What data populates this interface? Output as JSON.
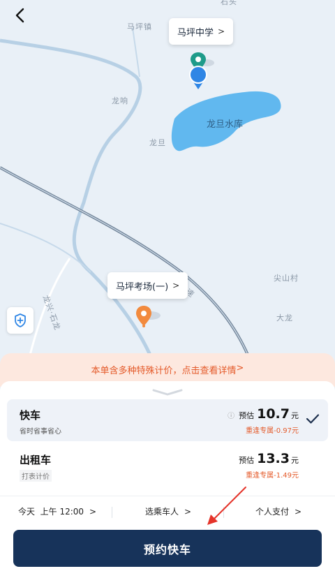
{
  "map": {
    "labels": {
      "top_village": "石头",
      "mapingzhen": "马坪镇",
      "longxiang": "龙响",
      "longdan": "龙旦",
      "jianshan": "尖山村",
      "dalong": "大龙",
      "road_a": "龙兴·石龙",
      "road_b": "高速"
    },
    "lake_label": "龙旦水库",
    "destination_callout": {
      "text": "马坪中学",
      "chevron": ">"
    },
    "origin_callout": {
      "text": "马坪考场(一)",
      "chevron": ">"
    },
    "colors": {
      "water": "#61b8ef",
      "road": "#b7d0e5",
      "highway": "#6e8196",
      "dest_pin": "#1e9b8a",
      "origin_pin": "#f28a3e",
      "current_location": "#2f86e5"
    }
  },
  "notice": {
    "text": "本单含多种特殊计价，点击查看详情",
    "chevron": ">"
  },
  "rides": [
    {
      "name": "快车",
      "subtitle": "省时省事省心",
      "est_prefix": "预估",
      "price": "10.7",
      "unit": "元",
      "discount": "重逢专属-0.97元",
      "info_icon": "info-icon",
      "selected": true
    },
    {
      "name": "出租车",
      "subtitle": "打表计价",
      "est_prefix": "预估",
      "price": "13.3",
      "unit": "元",
      "discount": "重逢专属-1.49元",
      "selected": false
    }
  ],
  "options": {
    "time": "今天  上午 12:00",
    "passenger": "选乘车人",
    "payment": "个人支付",
    "chevron": ">"
  },
  "book_button": "预约快车",
  "accent": {
    "primary": "#17335a",
    "discount": "#e45a2a",
    "notice_bg": "#fde8df"
  }
}
